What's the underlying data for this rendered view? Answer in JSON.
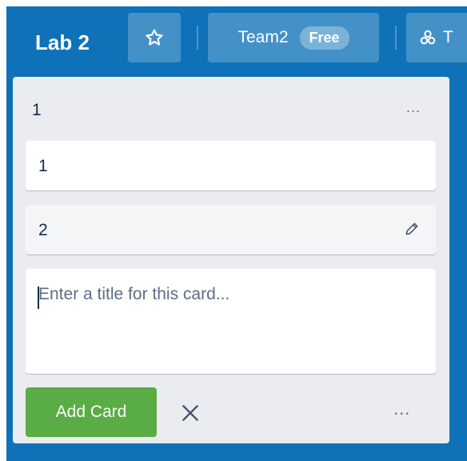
{
  "header": {
    "board_title": "Lab 2",
    "team_name": "Team2",
    "team_badge": "Free",
    "visibility_label": "T"
  },
  "list": {
    "title": "1",
    "menu_label": "...",
    "cards": [
      {
        "title": "1"
      },
      {
        "title": "2"
      }
    ]
  },
  "composer": {
    "placeholder": "Enter a title for this card...",
    "add_button_label": "Add Card",
    "more_label": "..."
  },
  "colors": {
    "board_bg": "#0f72b8",
    "list_bg": "#ebecf0",
    "add_button": "#5aac44"
  }
}
